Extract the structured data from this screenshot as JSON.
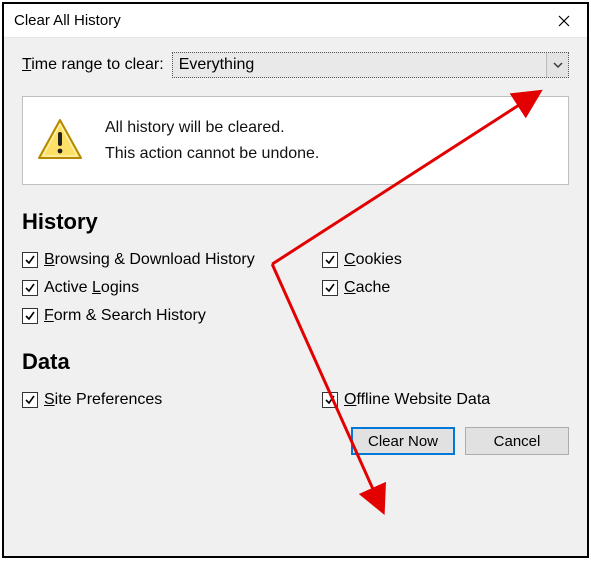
{
  "title": "Clear All History",
  "range": {
    "label_pre": "T",
    "label_underline": "",
    "label_full": "ime range to clear:",
    "selected": "Everything"
  },
  "warning": {
    "line1": "All history will be cleared.",
    "line2": "This action cannot be undone."
  },
  "sections": {
    "history_title": "History",
    "data_title": "Data"
  },
  "checks": {
    "browsing": {
      "u": "B",
      "rest": "rowsing & Download History",
      "checked": true
    },
    "cookies": {
      "u": "C",
      "rest": "ookies",
      "checked": true
    },
    "logins": {
      "pre": "Active ",
      "u": "L",
      "rest": "ogins",
      "checked": true
    },
    "cache": {
      "u": "C",
      "rest": "ache",
      "checked": true
    },
    "form": {
      "u": "F",
      "rest": "orm & Search History",
      "checked": true
    },
    "siteprefs": {
      "u": "S",
      "rest": "ite Preferences",
      "checked": true
    },
    "offline": {
      "u": "O",
      "rest": "ffline Website Data",
      "checked": true
    }
  },
  "buttons": {
    "clear": "Clear Now",
    "cancel": "Cancel"
  },
  "range_label_u": "T",
  "range_label_rest": "ime range to clear:"
}
